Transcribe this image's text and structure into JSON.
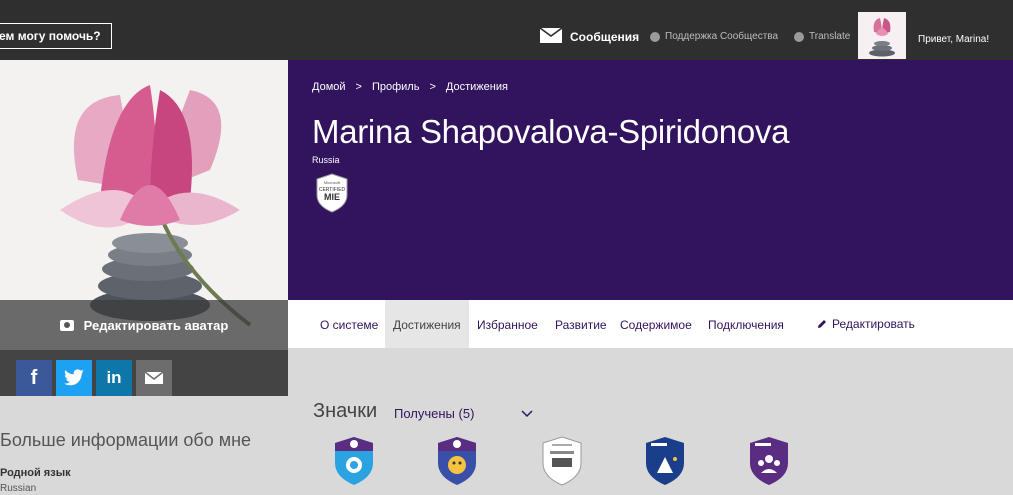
{
  "topbar": {
    "help_label": "ем могу помочь?",
    "messages_label": "Сообщения",
    "support_label": "Поддержка Сообщества",
    "translate_label": "Translate",
    "greeting": "Привет, Marina!"
  },
  "avatar": {
    "edit_label": "Редактировать аватар"
  },
  "social": {
    "facebook": "f",
    "twitter": "t",
    "linkedin": "in",
    "email_icon": "envelope-icon"
  },
  "breadcrumb": [
    "Домой",
    "Профиль",
    "Достижения"
  ],
  "breadcrumb_sep": ">",
  "profile": {
    "name": "Marina Shapovalova-Spiridonova",
    "country": "Russia",
    "badge_line1": "Microsoft",
    "badge_line2": "CERTIFIED",
    "badge_line3": "MIE"
  },
  "tabs": [
    {
      "label": "О системе"
    },
    {
      "label": "Достижения",
      "active": true
    },
    {
      "label": "Избранное"
    },
    {
      "label": "Развитие"
    },
    {
      "label": "Содержимое"
    },
    {
      "label": "Подключения"
    }
  ],
  "edit_tab": "Редактировать",
  "left_info": {
    "heading": "Больше информации обо мне",
    "native_label": "Родной язык",
    "native_value": "Russian"
  },
  "badges": {
    "title": "Значки",
    "filter": "Получены (5)",
    "items": [
      {
        "name": "collaboration-badge",
        "color": "#2aa3e0"
      },
      {
        "name": "skype-badge",
        "color": "#3a4fa8"
      },
      {
        "name": "mie-badge",
        "color": "#ffffff"
      },
      {
        "name": "mie-expert-badge",
        "color": "#1b3e8a"
      },
      {
        "name": "community-badge",
        "color": "#5a2d82"
      }
    ]
  },
  "colors": {
    "topbar": "#2f2f2f",
    "purple": "#31145d",
    "background": "#d9d9d9"
  }
}
